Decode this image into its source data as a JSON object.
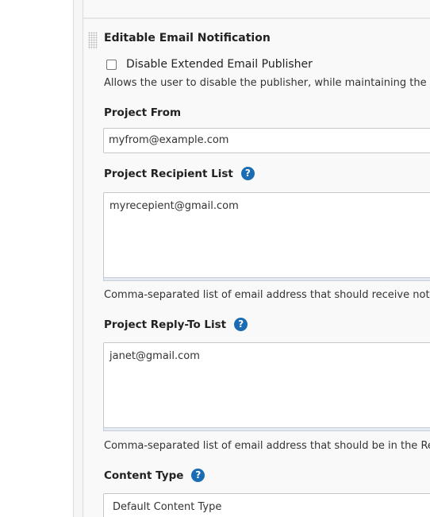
{
  "section": {
    "title": "Editable Email Notification"
  },
  "disable_publisher": {
    "label": "Disable Extended Email Publisher",
    "checked": false,
    "description": "Allows the user to disable the publisher, while maintaining the setti"
  },
  "project_from": {
    "label": "Project From",
    "value": "myfrom@example.com"
  },
  "recipient_list": {
    "label": "Project Recipient List",
    "help_icon": "question-circle-icon",
    "value": "myrecepient@gmail.com",
    "description": "Comma-separated list of email address that should receive notifica"
  },
  "reply_to_list": {
    "label": "Project Reply-To List",
    "help_icon": "question-circle-icon",
    "value": "janet@gmail.com",
    "description": "Comma-separated list of email address that should be in the Reply"
  },
  "content_type": {
    "label": "Content Type",
    "help_icon": "question-circle-icon",
    "selected": "Default Content Type"
  },
  "help_glyph": "?",
  "colors": {
    "help_icon": "#1b6db3",
    "panel_bg": "#f9f9f9",
    "border": "#c7c7c7"
  }
}
